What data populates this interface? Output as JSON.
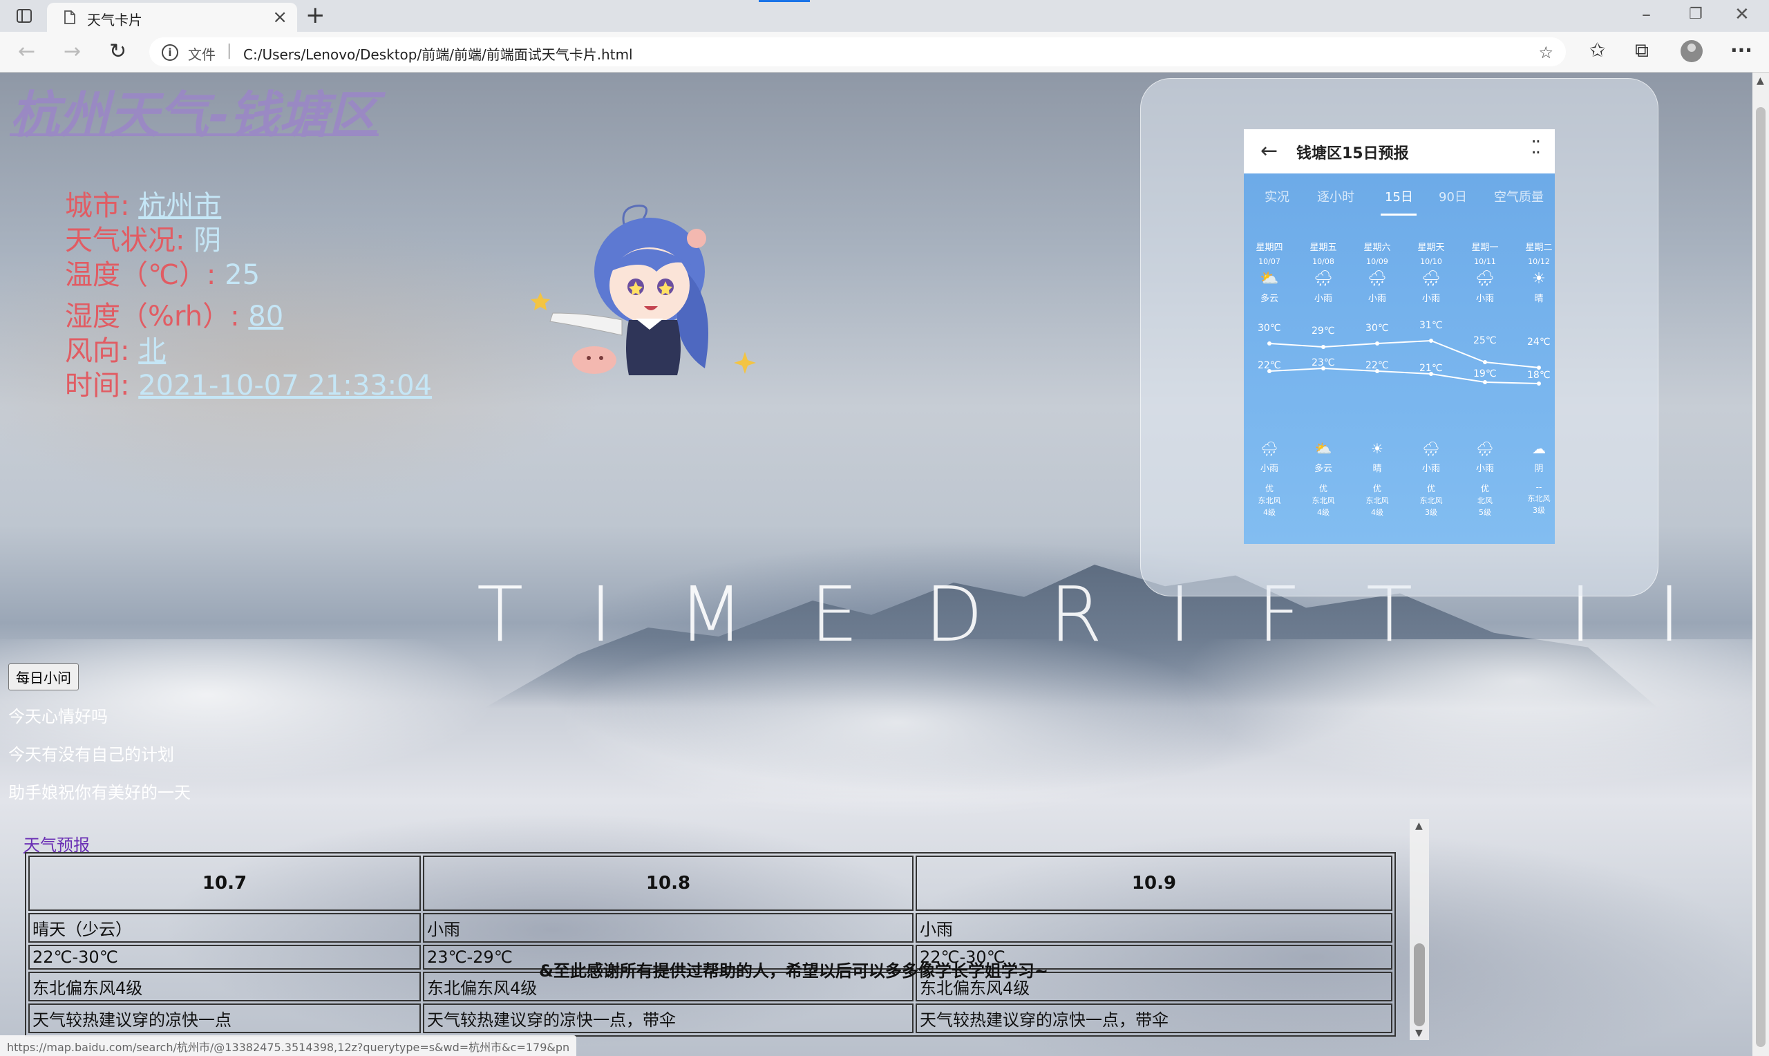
{
  "browser": {
    "tab_title": "天气卡片",
    "address_label": "文件",
    "url": "C:/Users/Lenovo/Desktop/前端/前端/前端面试天气卡片.html"
  },
  "page": {
    "title": "杭州天气-钱塘区",
    "info": {
      "city_label": "城市:",
      "city_value": "杭州市",
      "weather_label": "天气状况:",
      "weather_value": "阴",
      "temp_label": "温度（℃）:",
      "temp_value": "25",
      "humidity_label": "湿度（%rh）:",
      "humidity_value": "80",
      "wind_label": "风向:",
      "wind_value": "北",
      "time_label": "时间:",
      "time_value": "2021-10-07 21:33:04"
    },
    "watermark": "TIMEDRIFT II",
    "phone": {
      "title": "钱塘区15日预报",
      "tabs": [
        "实况",
        "逐小时",
        "15日",
        "90日",
        "空气质量"
      ],
      "days": [
        {
          "name": "星期四",
          "date": "10/07",
          "icon": "⛅",
          "cond": "多云",
          "high": "30℃",
          "low": "22℃",
          "night_icon": "🌧",
          "night_cond": "小雨",
          "aqi": "优",
          "wind_dir": "东北风",
          "wind_lvl": "4级"
        },
        {
          "name": "星期五",
          "date": "10/08",
          "icon": "🌧",
          "cond": "小雨",
          "high": "29℃",
          "low": "23℃",
          "night_icon": "⛅",
          "night_cond": "多云",
          "aqi": "优",
          "wind_dir": "东北风",
          "wind_lvl": "4级"
        },
        {
          "name": "星期六",
          "date": "10/09",
          "icon": "🌧",
          "cond": "小雨",
          "high": "30℃",
          "low": "22℃",
          "night_icon": "☀",
          "night_cond": "晴",
          "aqi": "优",
          "wind_dir": "东北风",
          "wind_lvl": "4级"
        },
        {
          "name": "星期天",
          "date": "10/10",
          "icon": "🌧",
          "cond": "小雨",
          "high": "31℃",
          "low": "21℃",
          "night_icon": "🌧",
          "night_cond": "小雨",
          "aqi": "优",
          "wind_dir": "东北风",
          "wind_lvl": "3级"
        },
        {
          "name": "星期一",
          "date": "10/11",
          "icon": "🌧",
          "cond": "小雨",
          "high": "25℃",
          "low": "19℃",
          "night_icon": "🌧",
          "night_cond": "小雨",
          "aqi": "优",
          "wind_dir": "北风",
          "wind_lvl": "5级"
        },
        {
          "name": "星期二",
          "date": "10/12",
          "icon": "☀",
          "cond": "晴",
          "high": "24℃",
          "low": "18℃",
          "night_icon": "☁",
          "night_cond": "阴",
          "aqi": "--",
          "wind_dir": "东北风",
          "wind_lvl": "3级"
        }
      ]
    },
    "daily_button": "每日小问",
    "messages": [
      "今天心情好吗",
      "今天有没有自己的计划",
      "助手娘祝你有美好的一天"
    ],
    "forecast_link": "天气预报",
    "table": {
      "headers": [
        "10.7",
        "10.8",
        "10.9"
      ],
      "rows": [
        [
          "晴天（少云）",
          "小雨",
          "小雨"
        ],
        [
          "22℃-30℃",
          "23℃-29℃",
          "22℃-30℃"
        ],
        [
          "东北偏东风4级",
          "东北偏东风4级",
          "东北偏东风4级"
        ],
        [
          "天气较热建议穿的凉快一点",
          "天气较热建议穿的凉快一点，带伞",
          "天气较热建议穿的凉快一点，带伞"
        ]
      ]
    },
    "thanks": "&至此感谢所有提供过帮助的人，希望以后可以多多像学长学姐学习~",
    "status_url": "https://map.baidu.com/search/杭州市/@13382475.3514398,12z?querytype=s&wd=杭州市&c=179&pn"
  },
  "colors": {
    "title": "#9b86c8",
    "info_label": "#e15c63",
    "info_value": "#c5e6f6",
    "phone_bg": "#74b1ec"
  },
  "icons": [
    "page-icon",
    "tab-actions-icon",
    "back-icon",
    "forward-icon",
    "refresh-icon",
    "info-icon",
    "favorite-add-icon",
    "favorites-icon",
    "collections-icon",
    "profile-icon",
    "more-icon"
  ]
}
